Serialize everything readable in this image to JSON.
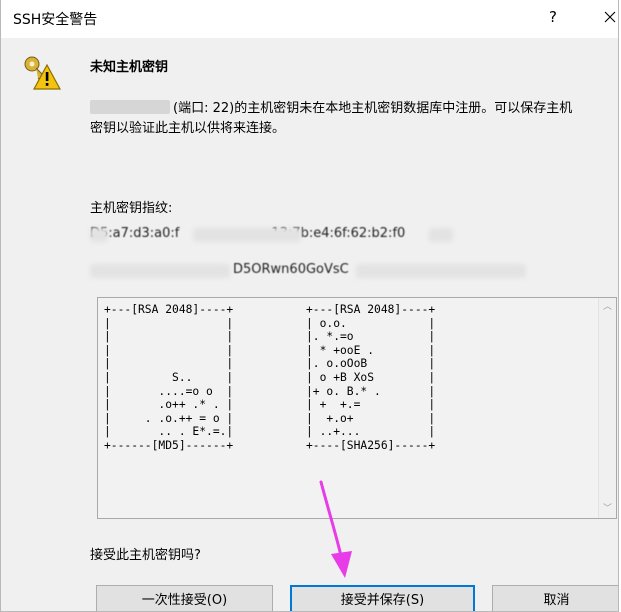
{
  "window": {
    "title": "SSH安全警告",
    "help": "?",
    "close_label": "close"
  },
  "header": {
    "heading": "未知主机密钥"
  },
  "message": {
    "line1_host_suffix": "(端口: 22)的主机密钥未在本地主机密钥数据库中注册。可以保存主机",
    "line2": "密钥以验证此主机以供将来连接。"
  },
  "fingerprint": {
    "label": "主机密钥指纹:",
    "md5_visible": "D5:a7:d3:a0:f",
    "md5_tail": "13:7b:e4:6f:62:b2:f0",
    "sha256_visible": "D5ORwn60GoVsC"
  },
  "randomart": {
    "md5": "+---[RSA 2048]----+\n|                 |\n|                 |\n|                 |\n|                 |\n|         S..     |\n|       ....=o o  |\n|       .o++ .* . |\n|     . .o.++ = o |\n|       .. . E*.=.|\n+------[MD5]------+",
    "sha256": "+---[RSA 2048]----+\n| o.o.            |\n|. *.=o           |\n| * +ooE .        |\n|. o.oOoB         |\n| o +B XoS        |\n|+ o. B.* .       |\n| +  +.=          |\n|  +.o+           |\n| ..+...          |\n+----[SHA256]-----+"
  },
  "question": "接受此主机密钥吗?",
  "buttons": {
    "accept_once": "一次性接受(O)",
    "accept_save": "接受并保存(S)",
    "cancel": "取消"
  },
  "colors": {
    "focus_border": "#0078d7",
    "arrow": "#e83ce8",
    "dialog_bg": "#f0f0f0"
  },
  "icons": {
    "header": "key-warning-icon"
  }
}
